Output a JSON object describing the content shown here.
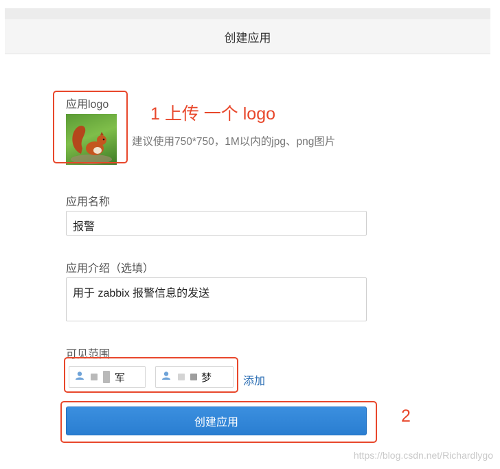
{
  "header": {
    "title": "创建应用"
  },
  "logo": {
    "label": "应用logo",
    "hint": "建议使用750*750，1M以内的jpg、png图片",
    "annotation": "1 上传 一个 logo"
  },
  "name": {
    "label": "应用名称",
    "value": "报警"
  },
  "intro": {
    "label": "应用介绍（选填）",
    "value": "用于 zabbix 报警信息的发送"
  },
  "visibility": {
    "label": "可见范围",
    "members": [
      {
        "name_visible": "军"
      },
      {
        "name_visible": "梦"
      }
    ],
    "add_label": "添加"
  },
  "submit": {
    "label": "创建应用",
    "annotation": "2"
  },
  "watermark": "https://blog.csdn.net/Richardlygo",
  "colors": {
    "accent": "#2a7ed1",
    "annotation": "#e8472b",
    "link": "#2a6db3"
  }
}
